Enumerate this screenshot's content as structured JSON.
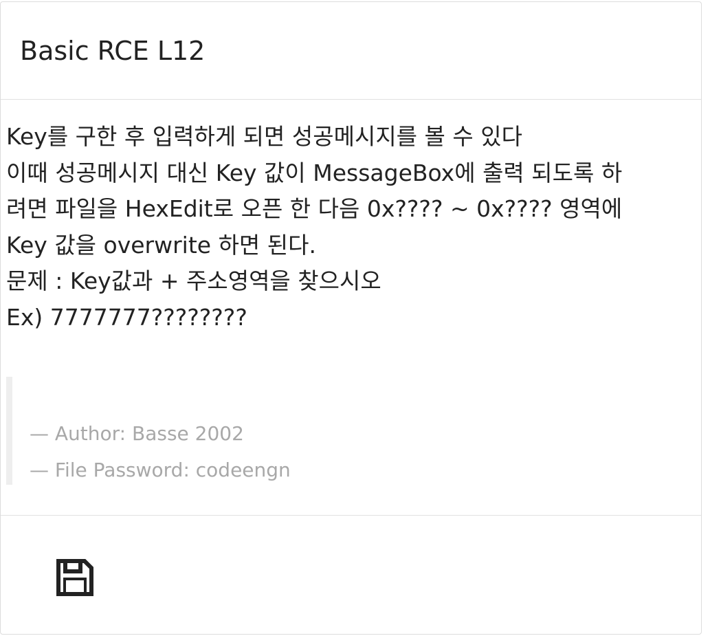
{
  "header": {
    "title": "Basic RCE L12"
  },
  "body": {
    "description_lines": [
      "Key를 구한 후 입력하게 되면 성공메시지를 볼 수 있다",
      "이때 성공메시지 대신 Key 값이 MessageBox에 출력 되도록 하",
      "려면 파일을 HexEdit로 오픈 한 다음 0x???? ~ 0x???? 영역에",
      "Key 값을 overwrite 하면 된다.",
      "문제 : Key값과 + 주소영역을 찾으시오",
      "Ex) 7777777????????"
    ],
    "quote": {
      "author": "— Author: Basse 2002",
      "password": "— File Password: codeengn"
    }
  },
  "footer": {
    "download_icon": "floppy-disk-icon"
  },
  "colors": {
    "text": "#222222",
    "muted": "#a8a8a8",
    "border": "#dcdcdc",
    "quote_bar": "#eeeeee"
  }
}
